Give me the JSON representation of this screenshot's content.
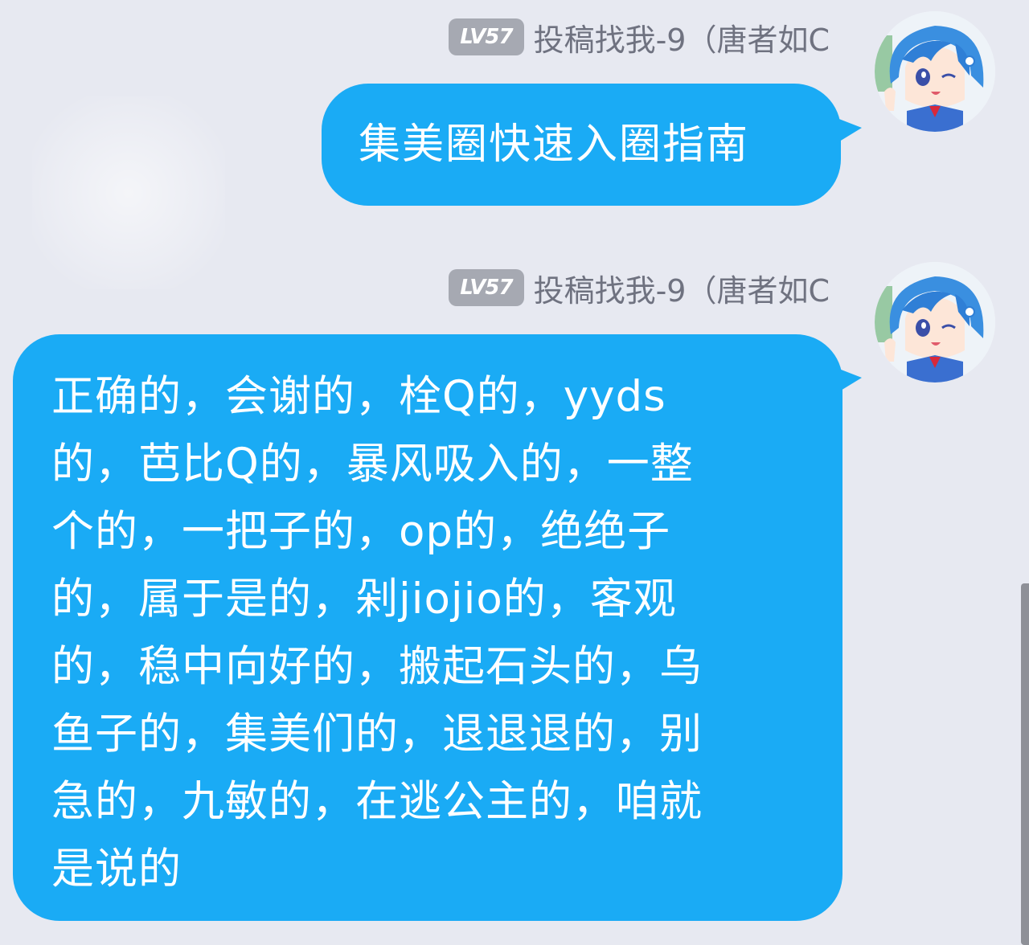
{
  "messages": [
    {
      "level": "LV57",
      "sender": "投稿找我-9（唐者如C",
      "text": "集美圈快速入圈指南"
    },
    {
      "level": "LV57",
      "sender": "投稿找我-9（唐者如C",
      "lines": [
        "正确的，会谢的，栓Q的，yyds",
        "的，芭比Q的，暴风吸入的，一整",
        "个的，一把子的，op的，绝绝子",
        "的，属于是的，剁jiojio的，客观",
        "的，稳中向好的，搬起石头的，乌",
        "鱼子的，集美们的，退退退的，别",
        "急的，九敏的，在逃公主的，咱就",
        "是说的"
      ]
    }
  ],
  "colors": {
    "background": "#e7e9f1",
    "bubble": "#1aabf5",
    "level_badge": "#a6a9b2",
    "sender_text": "#6f7280"
  },
  "icons": {
    "avatar": "anime-avatar-icon"
  }
}
